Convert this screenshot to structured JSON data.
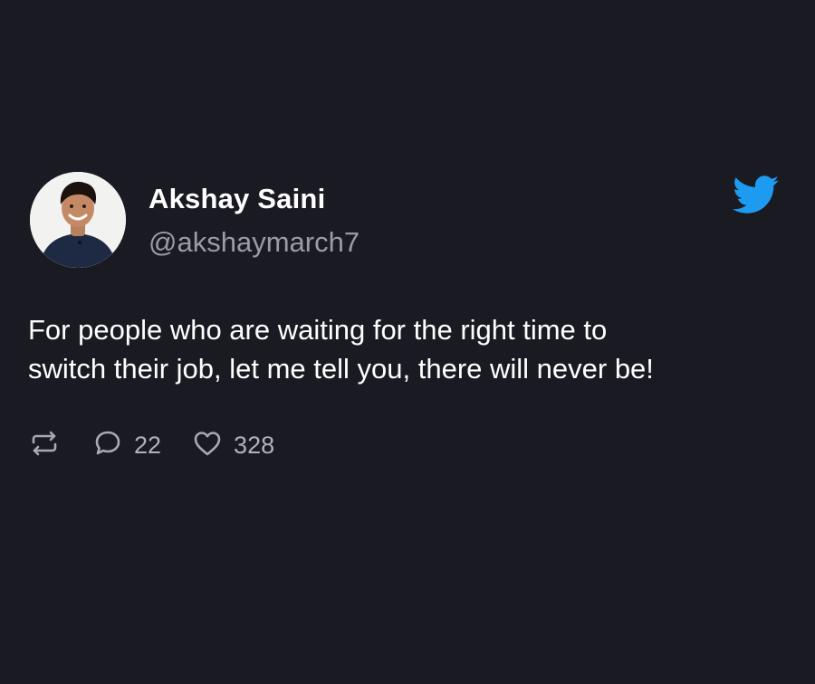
{
  "author": {
    "name": "Akshay Saini",
    "handle": "@akshaymarch7"
  },
  "tweet": {
    "text_line1": "For people who are waiting for the right time to",
    "text_line2": "switch their job, let me tell you, there will never be!"
  },
  "actions": {
    "retweet_icon": "retweet-icon",
    "reply_icon": "comment-icon",
    "reply_count": "22",
    "like_icon": "heart-icon",
    "like_count": "328"
  },
  "brand": {
    "logo": "twitter-bird-icon",
    "color": "#1d9bf0"
  },
  "colors": {
    "background": "#1a1b22",
    "text": "#ffffff",
    "muted": "#9a9ca4"
  }
}
